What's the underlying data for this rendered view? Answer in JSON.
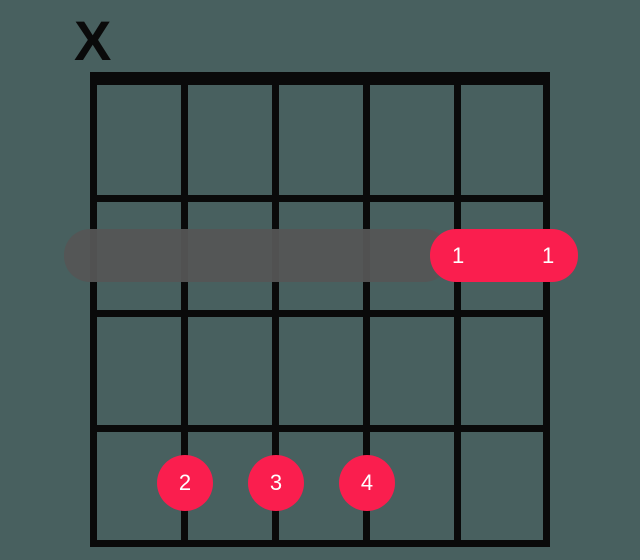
{
  "chart_data": {
    "type": "guitar-chord-diagram",
    "strings": 6,
    "frets_shown": 4,
    "string_markers": [
      "X",
      "",
      "",
      "",
      "",
      ""
    ],
    "barre": {
      "fret": 2,
      "from_string": 2,
      "to_string": 1,
      "finger": 1,
      "shadow_from_string": 6
    },
    "dots": [
      {
        "string": 5,
        "fret": 4,
        "finger": 2
      },
      {
        "string": 4,
        "fret": 4,
        "finger": 3
      },
      {
        "string": 3,
        "fret": 4,
        "finger": 4
      }
    ]
  },
  "labels": {
    "mute": "X",
    "barre_left": "1",
    "barre_right": "1",
    "dot0": "2",
    "dot1": "3",
    "dot2": "4"
  },
  "colors": {
    "background": "#48605f",
    "grid": "#0a0a0a",
    "dot": "#fa1e4e",
    "shadow": "#555555"
  }
}
